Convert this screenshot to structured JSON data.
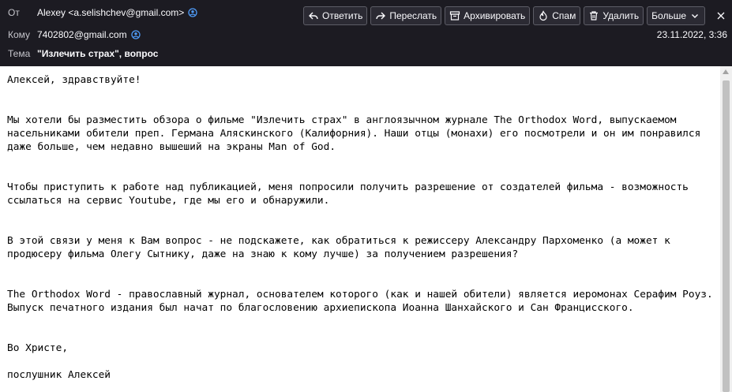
{
  "header": {
    "from_label": "От",
    "from_value": "Alexey <a.selishchev@gmail.com>",
    "to_label": "Кому",
    "to_value": "7402802@gmail.com",
    "date": "23.11.2022, 3:36",
    "subject_label": "Тема",
    "subject_value": "\"Излечить страх\", вопрос"
  },
  "toolbar": {
    "reply": "Ответить",
    "forward": "Переслать",
    "archive": "Архивировать",
    "spam": "Спам",
    "delete": "Удалить",
    "more": "Больше"
  },
  "message": {
    "greeting": "Алексей, здравствуйте!",
    "p1": "Мы хотели бы разместить обзора о фильме \"Излечить страх\" в англоязычном журнале The Orthodox Word, выпускаемом насельниками обители преп. Германа Аляскинского (Калифорния). Наши отцы (монахи) его посмотрели и он им понравился даже больше, чем недавно вышеший на экраны Man of God.",
    "p2": "Чтобы приступить к работе над публикацией, меня попросили получить разрешение от создателей фильма - возможность ссылаться на сервис Youtube, где мы его и обнаружили.",
    "p3": "В этой связи у меня к Вам вопрос - не подскажете, как обратиться к режиссеру Александру Пархоменко (а может к продюсеру фильма Олегу Сытнику, даже на знаю к кому лучше) за получением разрешения?",
    "p4": "The Orthodox Word - православный журнал, основателем которого (как и нашей обители) является иеромонах Серафим Роуз. Выпуск печатного издания был начат по благословению архиепископа Иоанна Шанхайского и Сан Францисского.",
    "closing": "Во Христе,",
    "signature": "послушник Алексей"
  }
}
